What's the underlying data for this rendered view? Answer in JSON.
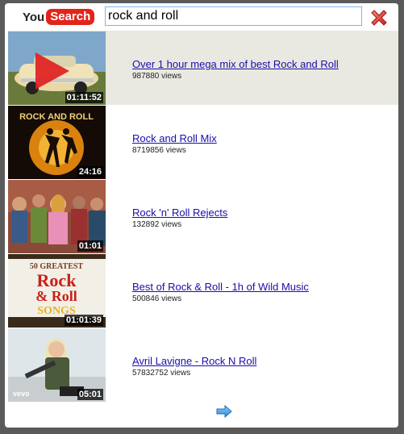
{
  "logo": {
    "you": "You",
    "search": "Search"
  },
  "search": {
    "value": "rock and roll"
  },
  "results": [
    {
      "title": "Over 1 hour mega mix of best Rock and Roll",
      "views": "987880 views",
      "duration": "01:11:52",
      "thumb_icon": "classic-car-with-play-icon"
    },
    {
      "title": "Rock and Roll Mix",
      "views": "8719856 views",
      "duration": "24:16",
      "thumb_icon": "dancing-couple-thumbnail"
    },
    {
      "title": "Rock 'n' Roll Rejects",
      "views": "132892 views",
      "duration": "01:01",
      "thumb_icon": "crowd-thumbnail"
    },
    {
      "title": "Best of Rock & Roll - 1h of Wild Music",
      "views": "500846 views",
      "duration": "01:01:39",
      "thumb_icon": "rock-and-roll-songs-thumbnail"
    },
    {
      "title": "Avril Lavigne - Rock N Roll",
      "views": "57832752 views",
      "duration": "05:01",
      "thumb_icon": "singer-guitar-thumbnail"
    }
  ],
  "thumb_text": {
    "rock_and_roll": "ROCK AND ROLL",
    "greatest": "50 GREATEST",
    "rock": "Rock",
    "roll": "& Roll",
    "songs": "SONGS",
    "vevo": "vevo"
  },
  "colors": {
    "accent_red": "#e3241b",
    "link": "#1a0dab",
    "highlight": "#eae9e1",
    "arrow": "#3d9be0"
  }
}
